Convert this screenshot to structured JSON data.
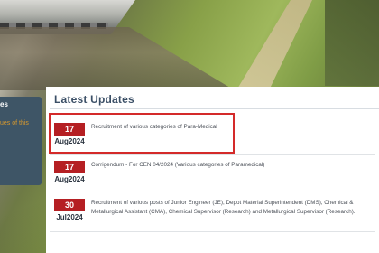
{
  "sidebar": {
    "title": "es",
    "text": "ues of this"
  },
  "latest_updates": {
    "title": "Latest Updates",
    "items": [
      {
        "day": "17",
        "month_year": "Aug2024",
        "text": "Recruitment of various categories of Para-Medical"
      },
      {
        "day": "17",
        "month_year": "Aug2024",
        "text": "Corrigendum - For CEN 04/2024 (Various categories of Paramedical)"
      },
      {
        "day": "30",
        "month_year": "Jul2024",
        "text": "Recruitment of various posts of Junior Engineer (JE), Depot Material Superintendent (DMS), Chemical & Metallurgical Assistant (CMA), Chemical Supervisor (Research) and Metallurgical Supervisor (Research)."
      }
    ]
  },
  "colors": {
    "date_badge": "#b51f23",
    "section_title": "#3b4f66",
    "side_panel": "#3e5566",
    "highlight_box": "#d42a2a"
  }
}
